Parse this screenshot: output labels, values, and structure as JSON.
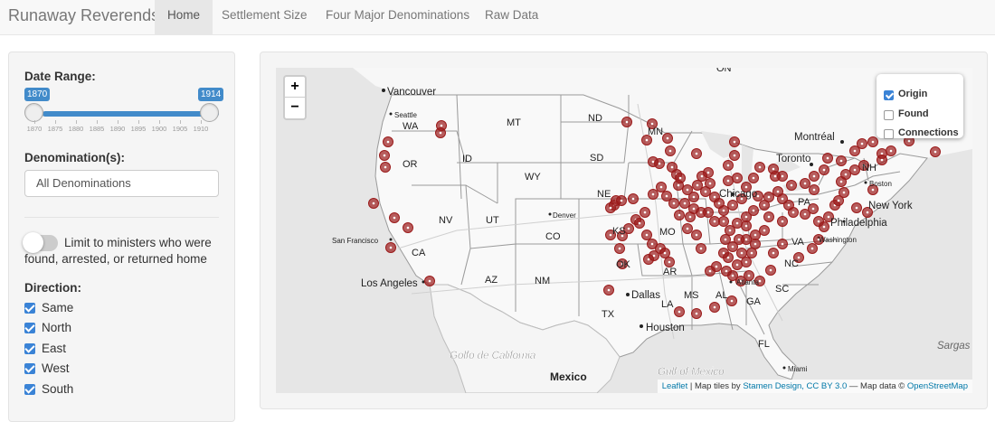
{
  "app": {
    "title": "Runaway Reverends"
  },
  "nav": {
    "tabs": [
      {
        "label": "Home",
        "active": true
      },
      {
        "label": "Settlement Size",
        "active": false
      },
      {
        "label": "Four Major Denominations",
        "active": false
      },
      {
        "label": "Raw Data",
        "active": false
      }
    ]
  },
  "sidebar": {
    "date_range": {
      "label": "Date Range:",
      "min": 1870,
      "max": 1914,
      "from": "1870",
      "to": "1914",
      "ticks": [
        "1870",
        "1875",
        "1880",
        "1885",
        "1890",
        "1895",
        "1900",
        "1905",
        "1910"
      ]
    },
    "denomination": {
      "label": "Denomination(s):",
      "value": "All Denominations"
    },
    "limit_toggle": {
      "line1": "Limit to ministers who were",
      "line2": "found, arrested, or returned home",
      "on": false
    },
    "direction": {
      "label": "Direction:",
      "options": [
        {
          "label": "Same",
          "checked": true
        },
        {
          "label": "North",
          "checked": true
        },
        {
          "label": "East",
          "checked": true
        },
        {
          "label": "West",
          "checked": true
        },
        {
          "label": "South",
          "checked": true
        }
      ]
    }
  },
  "map": {
    "zoom_in": "+",
    "zoom_out": "−",
    "layers": [
      {
        "label": "Origin",
        "checked": true
      },
      {
        "label": "Found",
        "checked": false
      },
      {
        "label": "Connections",
        "checked": false
      }
    ],
    "labels": {
      "on": "ON",
      "vancouver": "Vancouver",
      "seattle": "Seattle",
      "wa": "WA",
      "or": "OR",
      "id": "ID",
      "mt": "MT",
      "nd": "ND",
      "mn": "MN",
      "wy": "WY",
      "sd": "SD",
      "ne": "NE",
      "nv": "NV",
      "ut": "UT",
      "co": "CO",
      "denver": "Denver",
      "ca": "CA",
      "sf": "San Francisco",
      "la_city": "Los Angeles",
      "az": "AZ",
      "nm": "NM",
      "ok": "OK",
      "tx": "TX",
      "dallas": "Dallas",
      "houston": "Houston",
      "ks": "KS",
      "mo": "MO",
      "ar": "AR",
      "la": "LA",
      "ms": "MS",
      "al": "AL",
      "ga": "GA",
      "sc": "SC",
      "fl": "FL",
      "miami": "Miami",
      "montreal": "Montréal",
      "toronto": "Toronto",
      "chicago": "Chicago",
      "pa": "PA",
      "ny": "New York",
      "philadelphia": "Philadelphia",
      "washington": "Washington",
      "va": "VA",
      "nc": "NC",
      "boston": "Boston",
      "nh": "NH",
      "atlanta": "Atlanta",
      "golfo": "Golfo de California",
      "gulf": "Gulf of Mexico",
      "mexico": "Mexico",
      "sargasso": "Sargas"
    },
    "attribution": {
      "leaflet": "Leaflet",
      "tiles": " | Map tiles by ",
      "stamen": "Stamen Design, CC BY 3.0",
      "data": " — Map data © ",
      "osm": "OpenStreetMap"
    },
    "marker_color": "#9b1b1b"
  }
}
